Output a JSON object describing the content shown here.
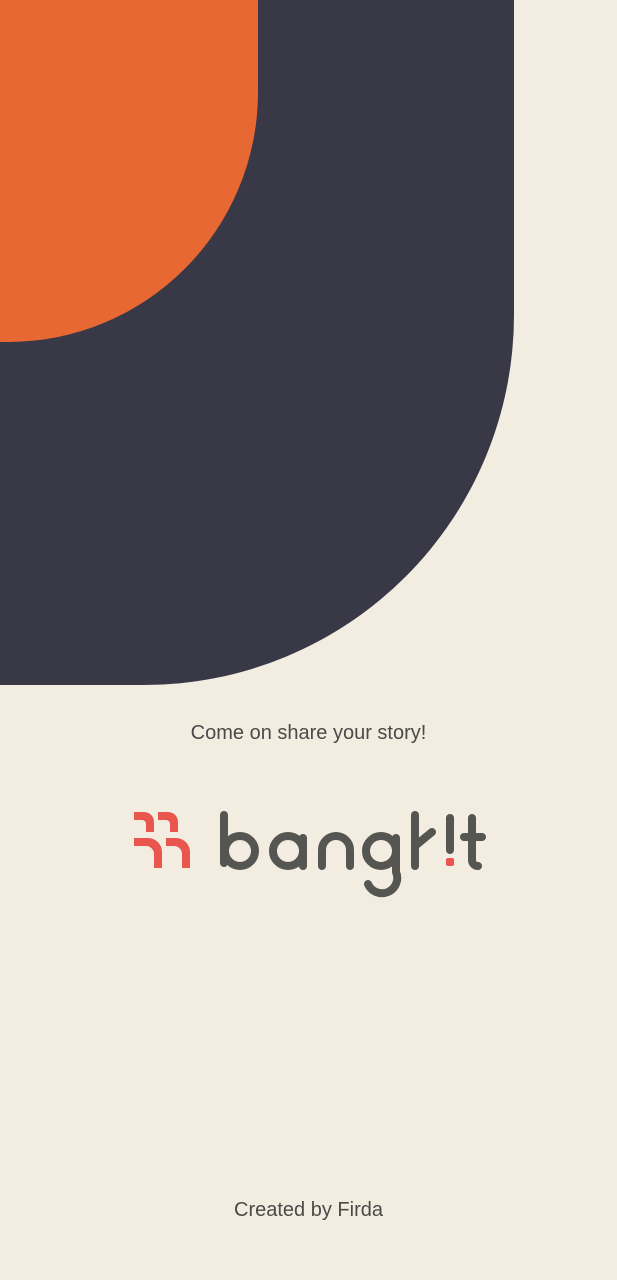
{
  "screen": {
    "tagline": "Come on share your story!",
    "credit": "Created by Firda"
  },
  "logo": {
    "wordmark": "bangkit",
    "mark_icon": "bangkit-mark-icon"
  },
  "colors": {
    "background": "#F3EDE1",
    "dark_shape": "#393847",
    "accent_orange": "#E76832",
    "logo_red": "#E8564D",
    "logo_text": "#555552"
  }
}
